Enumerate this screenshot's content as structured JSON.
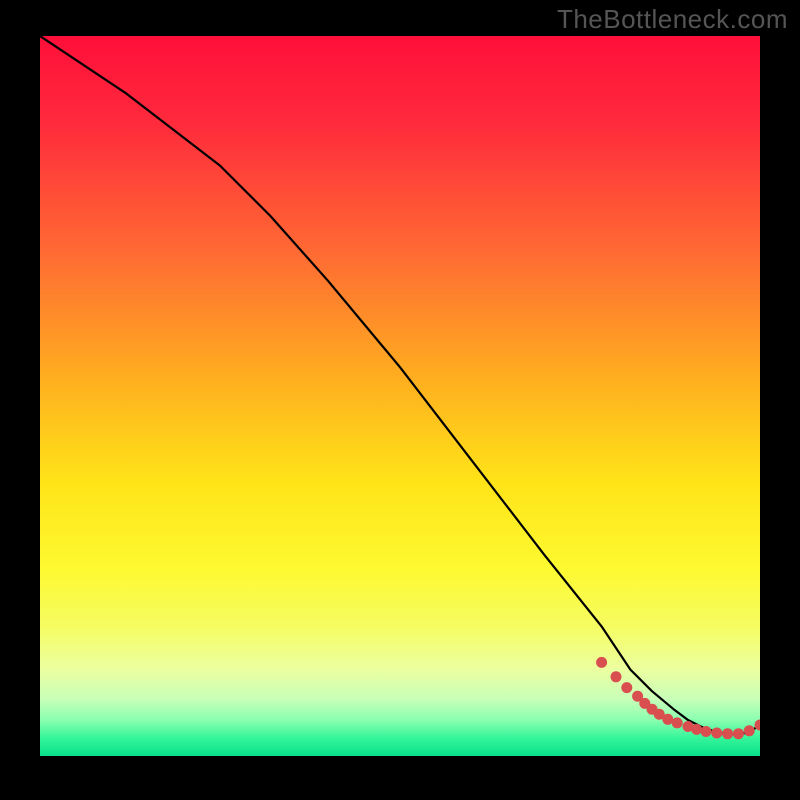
{
  "watermark": "TheBottleneck.com",
  "gradient_stops": [
    {
      "pct": 0,
      "color": "#ff0f3a"
    },
    {
      "pct": 12,
      "color": "#ff2a3c"
    },
    {
      "pct": 30,
      "color": "#ff6a33"
    },
    {
      "pct": 48,
      "color": "#ffb01f"
    },
    {
      "pct": 62,
      "color": "#ffe418"
    },
    {
      "pct": 74,
      "color": "#fdf930"
    },
    {
      "pct": 82,
      "color": "#f6fd62"
    },
    {
      "pct": 88,
      "color": "#ebffa0"
    },
    {
      "pct": 92,
      "color": "#c9ffb8"
    },
    {
      "pct": 95,
      "color": "#8affb0"
    },
    {
      "pct": 97.5,
      "color": "#35f59a"
    },
    {
      "pct": 100,
      "color": "#07e08a"
    }
  ],
  "chart_data": {
    "type": "line",
    "title": "",
    "xlabel": "",
    "ylabel": "",
    "xlim": [
      0,
      100
    ],
    "ylim": [
      0,
      100
    ],
    "series": [
      {
        "name": "curve",
        "x": [
          0,
          12,
          25,
          32,
          40,
          50,
          60,
          70,
          78,
          82,
          85,
          88,
          90,
          92,
          94,
          96,
          98,
          100
        ],
        "y": [
          100,
          92,
          82,
          75,
          66,
          54,
          41,
          28,
          18,
          12,
          9,
          6.5,
          5,
          4,
          3.3,
          3,
          3.2,
          4.2
        ]
      },
      {
        "name": "dots",
        "x": [
          78,
          80,
          81.5,
          83,
          84,
          85,
          86,
          87.2,
          88.5,
          90,
          91.2,
          92.5,
          94,
          95.5,
          97,
          98.5,
          100
        ],
        "y": [
          13,
          11,
          9.5,
          8.3,
          7.3,
          6.5,
          5.8,
          5.1,
          4.6,
          4.1,
          3.7,
          3.4,
          3.2,
          3.1,
          3.1,
          3.5,
          4.3
        ]
      }
    ],
    "curve_color": "#000000",
    "dot_color": "#d94f4f"
  }
}
